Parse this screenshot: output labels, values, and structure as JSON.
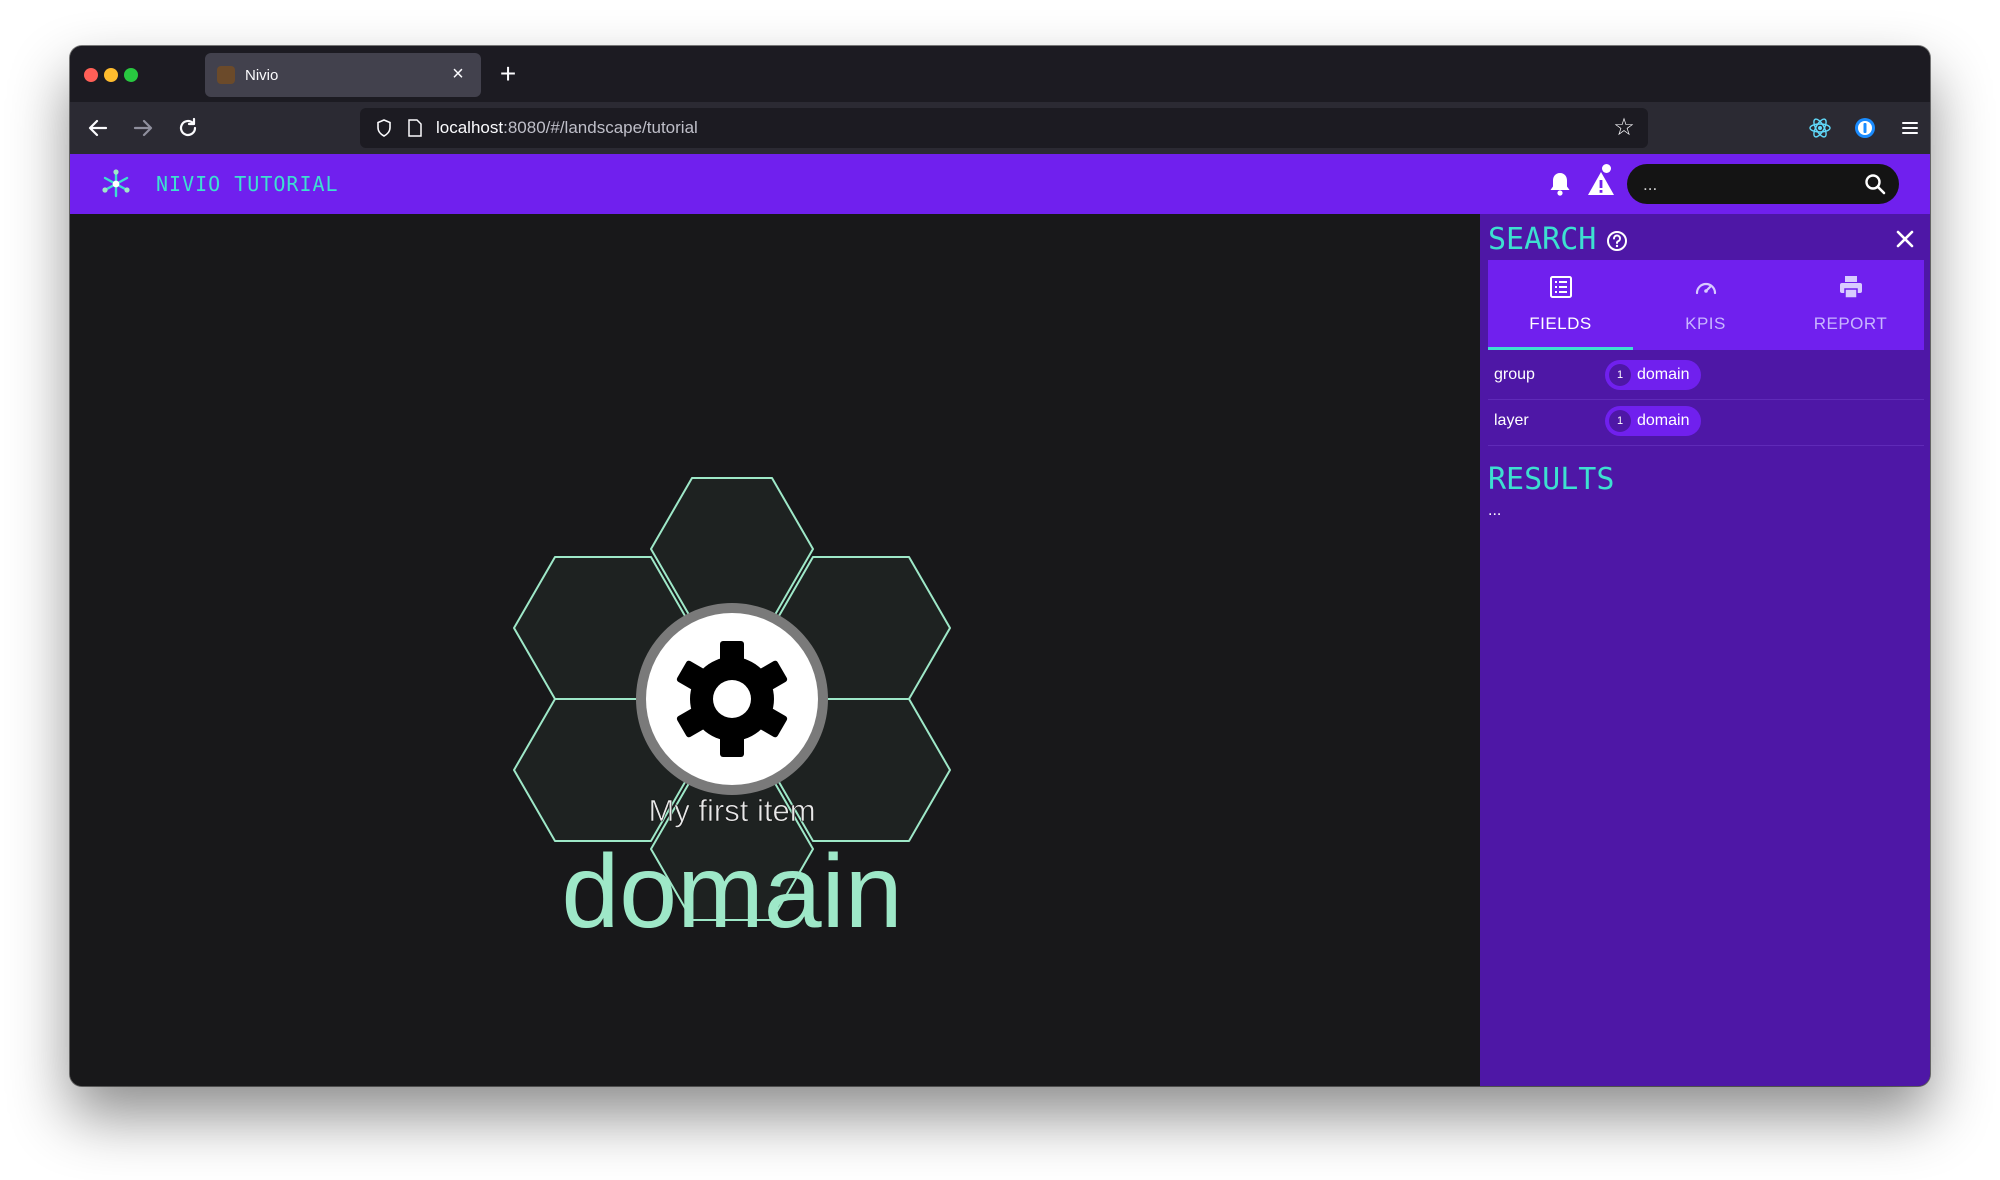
{
  "browser": {
    "tab_title": "Nivio",
    "url_host": "localhost",
    "url_rest": ":8080/#/landscape/tutorial"
  },
  "app": {
    "title": "NIVIO TUTORIAL",
    "search_placeholder": "...",
    "brand_color": "#7020ee",
    "accent_color": "#3de0d0"
  },
  "canvas": {
    "item_label": "My first item",
    "group_label": "domain",
    "item_icon": "gear-icon",
    "hex_stroke_color": "#9ee8c8"
  },
  "panel": {
    "title": "SEARCH",
    "tabs": [
      {
        "label": "FIELDS",
        "icon": "list-icon",
        "active": true
      },
      {
        "label": "KPIS",
        "icon": "speedometer-icon",
        "active": false
      },
      {
        "label": "REPORT",
        "icon": "printer-icon",
        "active": false
      }
    ],
    "fields": [
      {
        "name": "group",
        "count": "1",
        "value": "domain"
      },
      {
        "name": "layer",
        "count": "1",
        "value": "domain"
      }
    ],
    "results_title": "RESULTS",
    "results_text": "..."
  }
}
